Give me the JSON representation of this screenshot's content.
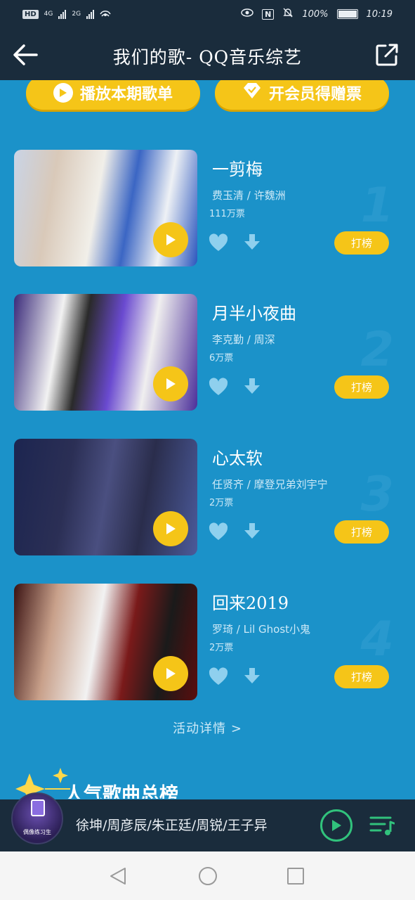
{
  "status_bar": {
    "hd": "HD",
    "net1": "4G",
    "net2": "2G",
    "nfc": "N",
    "battery_pct_text": "100%",
    "battery_level": 1.0,
    "time": "10:19"
  },
  "header": {
    "title": "我们的歌- QQ音乐综艺"
  },
  "actions": {
    "play_label": "播放本期歌单",
    "vip_label": "开会员得赠票"
  },
  "songs": [
    {
      "title": "一剪梅",
      "artists": "费玉清 / 许魏洲",
      "votes": "111万票",
      "rank": "1",
      "rank_button": "打榜"
    },
    {
      "title": "月半小夜曲",
      "artists": "李克勤 / 周深",
      "votes": "6万票",
      "rank": "2",
      "rank_button": "打榜"
    },
    {
      "title": "心太软",
      "artists": "任贤齐 / 摩登兄弟刘宇宁",
      "votes": "2万票",
      "rank": "3",
      "rank_button": "打榜"
    },
    {
      "title": "回来2019",
      "artists": "罗琦 / Lil Ghost小鬼",
      "votes": "2万票",
      "rank": "4",
      "rank_button": "打榜"
    }
  ],
  "footer": {
    "details_link": "活动详情 >",
    "section_title": "人气歌曲总榜"
  },
  "player": {
    "cover_label": "偶像练习生",
    "track": "徐坤/周彦辰/朱正廷/周锐/王子异"
  },
  "colors": {
    "background": "#1b92c9",
    "dark_bar": "#1a2c3c",
    "accent_yellow": "#f5c518",
    "play_green": "#31c27c"
  }
}
